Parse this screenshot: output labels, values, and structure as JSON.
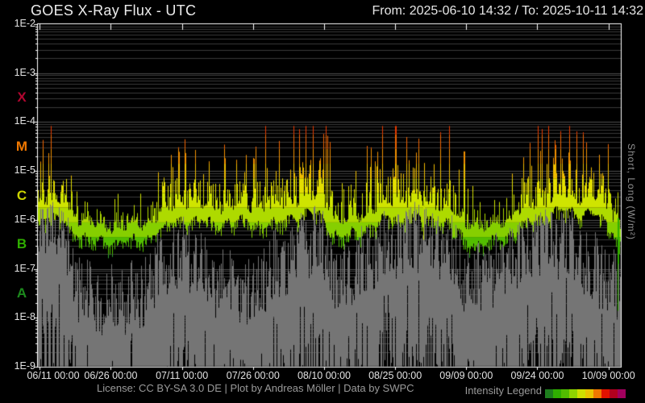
{
  "header": {
    "title": "GOES X-Ray Flux - UTC",
    "range_label": "From: 2025-06-10 14:32  /  To: 2025-10-11 14:32"
  },
  "footer": {
    "license": "License: CC BY-SA 3.0 DE | Plot by Andreas Möller | Data by SWPC"
  },
  "axes": {
    "right_label": "Short, Long (W/m²)"
  },
  "chart_data": {
    "type": "line",
    "title": "GOES X-Ray Flux - UTC",
    "x_axis": {
      "from": "2025-06-10 14:32",
      "to": "2025-10-11 14:32",
      "span_days": 123,
      "ticks": [
        "06/11 00:00",
        "06/26 00:00",
        "07/11 00:00",
        "07/26 00:00",
        "08/10 00:00",
        "08/25 00:00",
        "09/09 00:00",
        "09/24 00:00",
        "10/09 00:00"
      ],
      "tick_days": [
        0.39,
        15.39,
        30.39,
        45.39,
        60.39,
        75.39,
        90.39,
        105.39,
        120.39
      ]
    },
    "y_axis": {
      "scale": "log",
      "unit": "W/m²",
      "min_exp": -9,
      "max_exp": -2,
      "tick_labels": [
        "1E-2",
        "1E-3",
        "1E-4",
        "1E-5",
        "1E-6",
        "1E-7",
        "1E-8",
        "1E-9"
      ]
    },
    "flare_classes": [
      {
        "label": "X",
        "color": "#b20630",
        "band_center_log10": -3.5
      },
      {
        "label": "M",
        "color": "#f07800",
        "band_center_log10": -4.5
      },
      {
        "label": "C",
        "color": "#ccd400",
        "band_center_log10": -5.5
      },
      {
        "label": "B",
        "color": "#2fae00",
        "band_center_log10": -6.5
      },
      {
        "label": "A",
        "color": "#1d8a1d",
        "band_center_log10": -7.5
      }
    ],
    "grid": {
      "minor_color": "#3a3a3a",
      "major_color": "#4f4f4f",
      "border_color": "#ffffff"
    },
    "noise_seed": 20250610,
    "series": [
      {
        "name": "Long",
        "render": "intensity-colormap-columns",
        "colormap_stops": [
          [
            -6.7,
            "#2fa42f"
          ],
          [
            -6.35,
            "#52bd00"
          ],
          [
            -6.05,
            "#86cf00"
          ],
          [
            -5.75,
            "#aeda00"
          ],
          [
            -5.45,
            "#cfe400"
          ],
          [
            -5.15,
            "#e4df00"
          ],
          [
            -4.85,
            "#eebb00"
          ],
          [
            -4.55,
            "#f29100"
          ],
          [
            -4.25,
            "#f06400"
          ],
          [
            0,
            "#e83a00"
          ]
        ],
        "peak_cap_log10": -4.08,
        "baseline_keypoints": [
          [
            0,
            -5.85
          ],
          [
            2.2,
            -5.7
          ],
          [
            5,
            -5.85
          ],
          [
            9,
            -6.15
          ],
          [
            14,
            -6.3
          ],
          [
            22,
            -6.25
          ],
          [
            27,
            -5.95
          ],
          [
            31,
            -5.8
          ],
          [
            37,
            -5.9
          ],
          [
            44,
            -5.85
          ],
          [
            48,
            -5.95
          ],
          [
            54,
            -5.75
          ],
          [
            59,
            -5.7
          ],
          [
            63.5,
            -6.2
          ],
          [
            68,
            -6.05
          ],
          [
            75,
            -5.75
          ],
          [
            81,
            -5.8
          ],
          [
            87,
            -5.9
          ],
          [
            90,
            -6.25
          ],
          [
            94,
            -6.35
          ],
          [
            99,
            -6.15
          ],
          [
            103,
            -5.9
          ],
          [
            110,
            -5.65
          ],
          [
            117,
            -5.7
          ],
          [
            121,
            -6.0
          ],
          [
            123,
            -6.35
          ]
        ],
        "activity_keypoints": [
          [
            0,
            0.7
          ],
          [
            2.2,
            0.95
          ],
          [
            5,
            0.7
          ],
          [
            9,
            0.3
          ],
          [
            14,
            0.18
          ],
          [
            22,
            0.3
          ],
          [
            27,
            0.6
          ],
          [
            31,
            0.65
          ],
          [
            37,
            0.5
          ],
          [
            44,
            0.6
          ],
          [
            48,
            0.5
          ],
          [
            54,
            0.8
          ],
          [
            59,
            0.85
          ],
          [
            63.5,
            0.35
          ],
          [
            68,
            0.6
          ],
          [
            75,
            0.9
          ],
          [
            81,
            0.7
          ],
          [
            87,
            0.55
          ],
          [
            90,
            0.3
          ],
          [
            94,
            0.3
          ],
          [
            99,
            0.5
          ],
          [
            103,
            0.7
          ],
          [
            110,
            0.95
          ],
          [
            117,
            0.85
          ],
          [
            121,
            0.5
          ],
          [
            123,
            0.25
          ]
        ],
        "events": [
          {
            "day": 81.3,
            "kind": "dropout",
            "to_log10": -7.85,
            "color": "#c2dc00"
          },
          {
            "day": 89.8,
            "kind": "flare",
            "to_log10": -4.6
          },
          {
            "day": 122.4,
            "kind": "dropout",
            "to_log10": -8.0,
            "color": "#2fae00"
          }
        ]
      },
      {
        "name": "Short",
        "render": "gray-columns",
        "color": "#757575",
        "top_keypoints": [
          [
            0,
            -6.6
          ],
          [
            2.2,
            -5.9
          ],
          [
            5,
            -6.3
          ],
          [
            9,
            -7.5
          ],
          [
            14,
            -7.7
          ],
          [
            22,
            -7.5
          ],
          [
            27,
            -6.8
          ],
          [
            31,
            -6.7
          ],
          [
            37,
            -7.3
          ],
          [
            44,
            -7.5
          ],
          [
            48,
            -7.2
          ],
          [
            54,
            -6.6
          ],
          [
            59,
            -6.4
          ],
          [
            63.5,
            -7.2
          ],
          [
            68,
            -6.9
          ],
          [
            75,
            -6.4
          ],
          [
            81,
            -6.3
          ],
          [
            87,
            -6.6
          ],
          [
            90,
            -7.3
          ],
          [
            94,
            -7.2
          ],
          [
            99,
            -6.8
          ],
          [
            103,
            -6.5
          ],
          [
            110,
            -6.4
          ],
          [
            117,
            -7.0
          ],
          [
            121,
            -7.3
          ],
          [
            123,
            -7.5
          ]
        ]
      }
    ],
    "legend": {
      "label": "Intensity Legend",
      "colors": [
        "#1d7d1d",
        "#2fae00",
        "#52bd00",
        "#8fd400",
        "#cfe000",
        "#e9c400",
        "#f07800",
        "#e21200",
        "#b2001e",
        "#a2005e"
      ]
    }
  }
}
